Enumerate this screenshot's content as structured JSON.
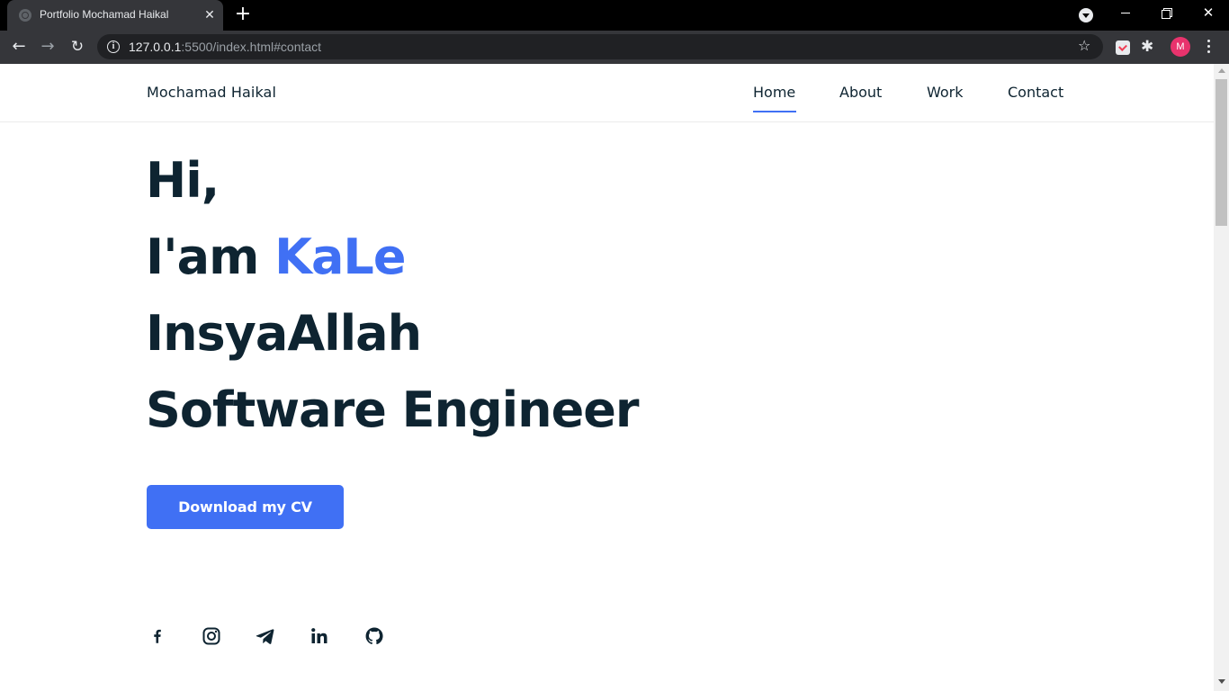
{
  "browser": {
    "tab_title": "Portfolio Mochamad Haikal",
    "tab_close": "✕",
    "new_tab": "+",
    "url_host": "127.0.0.1",
    "url_rest": ":5500/index.html#contact",
    "profile_initial": "M",
    "info_glyph": "i"
  },
  "header": {
    "brand": "Mochamad Haikal",
    "nav": [
      {
        "label": "Home",
        "active": true
      },
      {
        "label": "About"
      },
      {
        "label": "Work"
      },
      {
        "label": "Contact"
      }
    ]
  },
  "hero": {
    "line1": "Hi,",
    "line2_prefix": "I'am ",
    "line2_name": "KaLe",
    "line3": "InsyaAllah",
    "line4": "Software Engineer",
    "cta_label": "Download my CV"
  },
  "social": [
    "facebook-icon",
    "instagram-icon",
    "telegram-icon",
    "linkedin-icon",
    "github-icon"
  ],
  "colors": {
    "accent": "#4070f4",
    "text_dark": "#0e2431",
    "chrome_dark": "#35363a",
    "avatar": "#e8336d"
  }
}
